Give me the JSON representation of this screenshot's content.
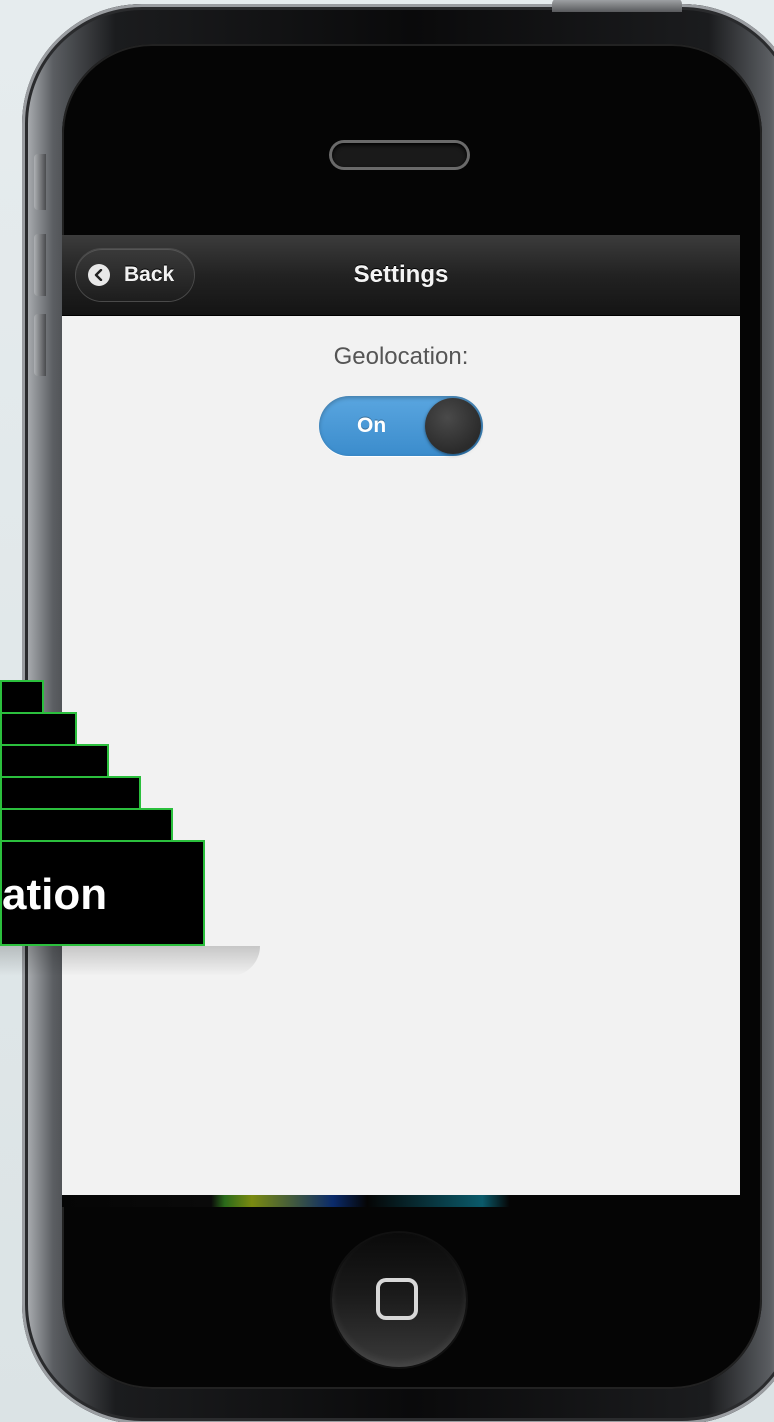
{
  "header": {
    "back_label": "Back",
    "title": "Settings"
  },
  "settings": {
    "geolocation_label": "Geolocation:",
    "toggle_state_label": "On",
    "toggle_on": true
  },
  "overlay": {
    "label_text": "ation"
  },
  "colors": {
    "header_bg": "#222222",
    "toggle_on": "#3b8ccc",
    "content_bg": "#f2f2f2",
    "overlay_border": "#2bbf3d"
  },
  "icons": {
    "back": "chevron-left-icon",
    "home": "home-square-icon"
  }
}
